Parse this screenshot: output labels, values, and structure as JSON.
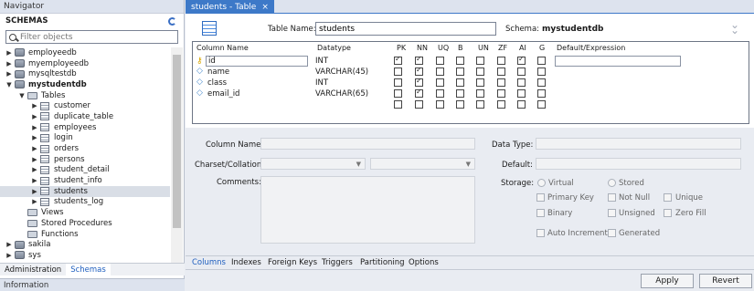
{
  "navigator": {
    "title": "Navigator",
    "schemas_label": "SCHEMAS",
    "filter_placeholder": "Filter objects",
    "tree": [
      {
        "label": "employeedb",
        "level": 0,
        "kind": "db",
        "expanded": false
      },
      {
        "label": "myemployeedb",
        "level": 0,
        "kind": "db",
        "expanded": false
      },
      {
        "label": "mysqltestdb",
        "level": 0,
        "kind": "db",
        "expanded": false
      },
      {
        "label": "mystudentdb",
        "level": 0,
        "kind": "db",
        "expanded": true,
        "bold": true
      },
      {
        "label": "Tables",
        "level": 1,
        "kind": "folder",
        "expanded": true
      },
      {
        "label": "customer",
        "level": 2,
        "kind": "table"
      },
      {
        "label": "duplicate_table",
        "level": 2,
        "kind": "table"
      },
      {
        "label": "employees",
        "level": 2,
        "kind": "table"
      },
      {
        "label": "login",
        "level": 2,
        "kind": "table"
      },
      {
        "label": "orders",
        "level": 2,
        "kind": "table"
      },
      {
        "label": "persons",
        "level": 2,
        "kind": "table"
      },
      {
        "label": "student_detail",
        "level": 2,
        "kind": "table"
      },
      {
        "label": "student_info",
        "level": 2,
        "kind": "table"
      },
      {
        "label": "students",
        "level": 2,
        "kind": "table",
        "selected": true
      },
      {
        "label": "students_log",
        "level": 2,
        "kind": "table"
      },
      {
        "label": "Views",
        "level": 1,
        "kind": "folder-leaf"
      },
      {
        "label": "Stored Procedures",
        "level": 1,
        "kind": "folder-leaf"
      },
      {
        "label": "Functions",
        "level": 1,
        "kind": "folder-leaf"
      },
      {
        "label": "sakila",
        "level": 0,
        "kind": "db",
        "expanded": false
      },
      {
        "label": "sys",
        "level": 0,
        "kind": "db",
        "expanded": false
      }
    ],
    "bottom_tabs": [
      "Administration",
      "Schemas"
    ],
    "active_bottom_tab": "Schemas",
    "info_label": "Information"
  },
  "editor_tab": {
    "label": "students - Table",
    "close": "×"
  },
  "table": {
    "name_label": "Table Name:",
    "name_value": "students",
    "schema_label": "Schema:",
    "schema_value": "mystudentdb"
  },
  "grid": {
    "headers": [
      "Column Name",
      "Datatype",
      "PK",
      "NN",
      "UQ",
      "B",
      "UN",
      "ZF",
      "AI",
      "G",
      "Default/Expression"
    ],
    "rows": [
      {
        "name": "id",
        "type": "INT",
        "icon": "primary-key",
        "flags": [
          true,
          true,
          false,
          false,
          false,
          false,
          true,
          false
        ]
      },
      {
        "name": "name",
        "type": "VARCHAR(45)",
        "icon": "column",
        "flags": [
          false,
          true,
          false,
          false,
          false,
          false,
          false,
          false
        ]
      },
      {
        "name": "class",
        "type": "INT",
        "icon": "column",
        "flags": [
          false,
          true,
          false,
          false,
          false,
          false,
          false,
          false
        ]
      },
      {
        "name": "email_id",
        "type": "VARCHAR(65)",
        "icon": "column",
        "flags": [
          false,
          true,
          false,
          false,
          false,
          false,
          false,
          false
        ]
      },
      {
        "name": "",
        "type": "",
        "icon": "",
        "flags": [
          false,
          false,
          false,
          false,
          false,
          false,
          false,
          false
        ]
      }
    ]
  },
  "details": {
    "column_name_label": "Column Name:",
    "data_type_label": "Data Type:",
    "charset_label": "Charset/Collation:",
    "default_label": "Default:",
    "comments_label": "Comments:",
    "storage_label": "Storage:",
    "storage_options": [
      "Virtual",
      "Stored"
    ],
    "flag_options": [
      "Primary Key",
      "Not Null",
      "Unique",
      "Binary",
      "Unsigned",
      "Zero Fill",
      "Auto Increment",
      "Generated"
    ]
  },
  "bottom_tabs": [
    "Columns",
    "Indexes",
    "Foreign Keys",
    "Triggers",
    "Partitioning",
    "Options"
  ],
  "active_bottom_tab": "Columns",
  "buttons": {
    "apply": "Apply",
    "revert": "Revert"
  },
  "colors": {
    "accent": "#3d79c8",
    "selection": "#d9dee6"
  }
}
